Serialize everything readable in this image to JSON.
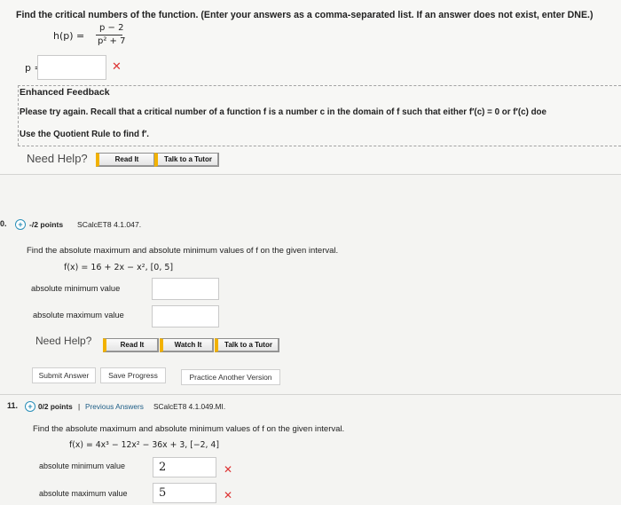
{
  "q9": {
    "instruction": "Find the critical numbers of the function. (Enter your answers as a comma-separated list. If an answer does not exist, enter DNE.)",
    "fn_lhs": "h(p) =",
    "fn_num": "p − 2",
    "fn_den": "p² + 7",
    "answer_label": "p =",
    "answer_value": "",
    "feedback_title": "Enhanced Feedback",
    "feedback_text": "Please try again. Recall that a critical number of a function f is a number c in the domain of f such that either f′(c) = 0 or f′(c) doe",
    "feedback_hint": "Use the Quotient Rule to find f′.",
    "need_help": "Need Help?",
    "read_it": "Read It",
    "talk_tutor": "Talk to a Tutor"
  },
  "q10": {
    "number": "0.",
    "points": "-/2 points",
    "source": "SCalcET8 4.1.047.",
    "instruction": "Find the absolute maximum and absolute minimum values of f on the given interval.",
    "fn": "f(x) = 16 + 2x − x²,   [0, 5]",
    "min_label": "absolute minimum value",
    "max_label": "absolute maximum value",
    "min_value": "",
    "max_value": "",
    "need_help": "Need Help?",
    "read_it": "Read It",
    "watch_it": "Watch It",
    "talk_tutor": "Talk to a Tutor",
    "submit": "Submit Answer",
    "save": "Save Progress",
    "practice": "Practice Another Version"
  },
  "q11": {
    "number": "11.",
    "points": "0/2 points",
    "sep": "|",
    "previous": "Previous Answers",
    "source": "SCalcET8 4.1.049.MI.",
    "instruction": "Find the absolute maximum and absolute minimum values of f on the given interval.",
    "fn": "f(x) = 4x³ − 12x² − 36x + 3,   [−2, 4]",
    "min_label": "absolute minimum value",
    "max_label": "absolute maximum value",
    "min_value": "2",
    "max_value": "5"
  }
}
